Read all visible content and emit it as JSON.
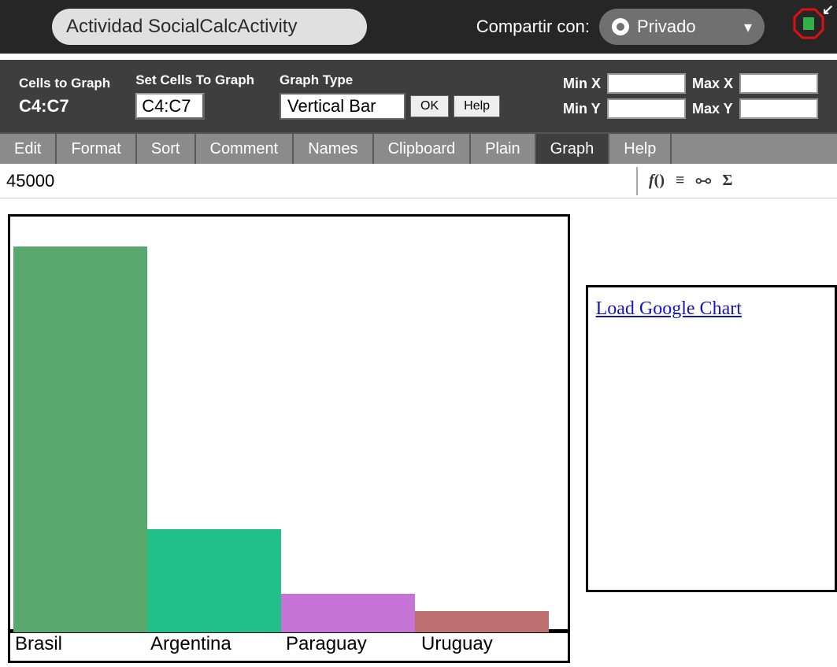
{
  "titlebar": {
    "activity_title": "Actividad SocialCalcActivity",
    "share_label": "Compartir con:",
    "share_value": "Privado"
  },
  "toolbar": {
    "cells_label": "Cells to Graph",
    "cells_value": "C4:C7",
    "set_cells_label": "Set Cells To Graph",
    "set_cells_input": "C4:C7",
    "graph_type_label": "Graph Type",
    "graph_type_value": "Vertical Bar",
    "ok_btn": "OK",
    "help_btn": "Help",
    "min_x_label": "Min X",
    "max_x_label": "Max X",
    "min_y_label": "Min Y",
    "max_y_label": "Max Y",
    "min_x": "",
    "max_x": "",
    "min_y": "",
    "max_y": ""
  },
  "tabs": [
    "Edit",
    "Format",
    "Sort",
    "Comment",
    "Names",
    "Clipboard",
    "Plain",
    "Graph",
    "Help"
  ],
  "active_tab": "Graph",
  "formula": {
    "value": "45000"
  },
  "side": {
    "link": "Load Google Chart"
  },
  "chart_data": {
    "type": "bar",
    "categories": [
      "Brasil",
      "Argentina",
      "Paraguay",
      "Uruguay"
    ],
    "values": [
      45000,
      12000,
      4500,
      2500
    ],
    "colors": [
      "#59a86e",
      "#21c08a",
      "#c574d6",
      "#bd7070"
    ],
    "title": "",
    "xlabel": "",
    "ylabel": "",
    "ylim": [
      0,
      45000
    ]
  }
}
